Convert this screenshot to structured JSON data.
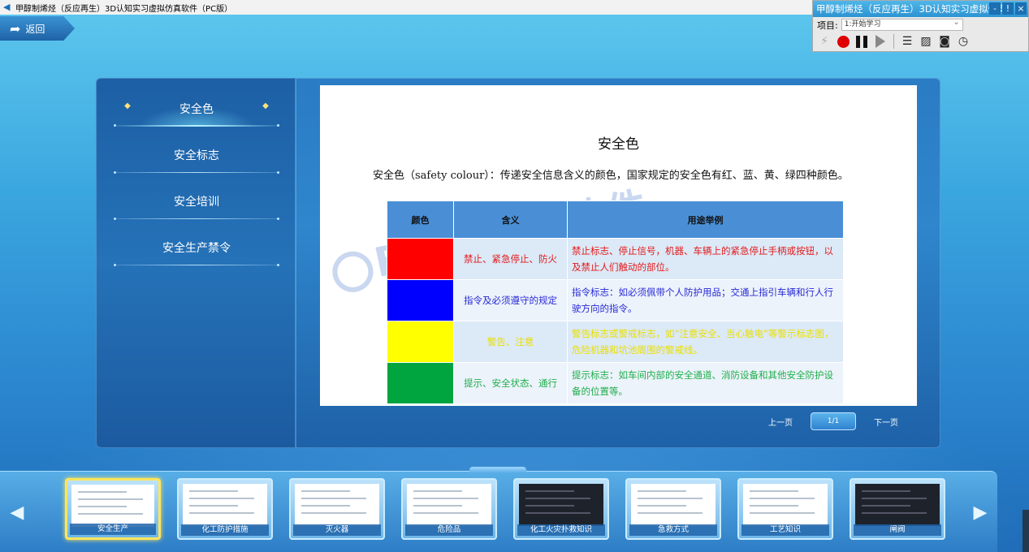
{
  "window": {
    "title": "甲醇制烯烃（反应再生）3D认知实习虚拟仿真软件（PC版）"
  },
  "float_panel": {
    "title": "甲醇制烯烃（反应再生）3D认知实习虚拟仿真",
    "project_label": "项目:",
    "project_value": "1:开始学习",
    "controls": [
      "-",
      "!",
      "×"
    ]
  },
  "back": {
    "label": "返回"
  },
  "sidebar": {
    "items": [
      {
        "label": "安全色",
        "active": true
      },
      {
        "label": "安全标志",
        "active": false
      },
      {
        "label": "安全培训",
        "active": false
      },
      {
        "label": "安全生产禁令",
        "active": false
      }
    ]
  },
  "content": {
    "title": "安全色",
    "description": "安全色（safety colour）：传递安全信息含义的颜色，国家规定的安全色有红、蓝、黄、绿四种颜色。",
    "watermark": "BP 欧倍尔软件",
    "table": {
      "headers": [
        "颜色",
        "含义",
        "用途举例"
      ],
      "rows": [
        {
          "color": "#ff0000",
          "text_color": "#e21b1b",
          "meaning": "禁止、紧急停止、防火",
          "usage": "禁止标志、停止信号，机器、车辆上的紧急停止手柄或按钮，以及禁止人们触动的部位。"
        },
        {
          "color": "#0000ff",
          "text_color": "#2a2ad6",
          "meaning": "指令及必须遵守的规定",
          "usage": "指令标志：如必须佩带个人防护用品；交通上指引车辆和行人行驶方向的指令。"
        },
        {
          "color": "#ffff00",
          "text_color": "#e8e000",
          "meaning": "警告、注意",
          "usage": "警告标志或警戒标志，如“注意安全、当心触电”等警示标志图，危险机器和坑池周围的警戒线。"
        },
        {
          "color": "#00a53f",
          "text_color": "#1fae4a",
          "meaning": "提示、安全状态、通行",
          "usage": "提示标志：如车间内部的安全通道、消防设备和其他安全防护设备的位置等。"
        }
      ]
    },
    "pager": {
      "prev": "上一页",
      "indicator": "1/1",
      "next": "下一页"
    }
  },
  "thumbnails": [
    {
      "caption": "安全生产",
      "active": true
    },
    {
      "caption": "化工防护措施",
      "active": false
    },
    {
      "caption": "灭火器",
      "active": false
    },
    {
      "caption": "危险品",
      "active": false
    },
    {
      "caption": "化工火灾扑救知识",
      "active": false
    },
    {
      "caption": "急救方式",
      "active": false
    },
    {
      "caption": "工艺知识",
      "active": false
    },
    {
      "caption": "闸阀",
      "active": false
    }
  ]
}
